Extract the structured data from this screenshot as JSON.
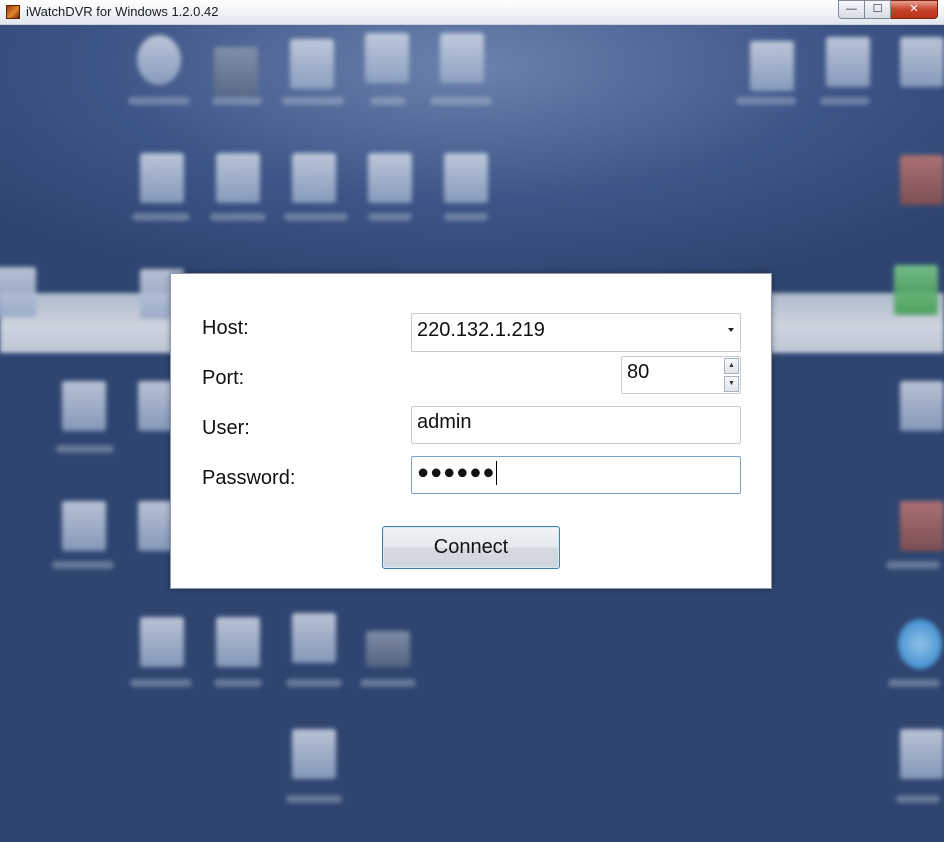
{
  "window": {
    "title": "iWatchDVR for Windows 1.2.0.42",
    "icon": "app-icon",
    "controls": {
      "minimize": "—",
      "maximize": "☐",
      "close": "✕"
    }
  },
  "dialog": {
    "host": {
      "label": "Host:",
      "value": "220.132.1.219"
    },
    "port": {
      "label": "Port:",
      "value": "80"
    },
    "user": {
      "label": "User:",
      "value": "admin"
    },
    "password": {
      "label": "Password:",
      "value": "●●●●●●"
    },
    "connect_label": "Connect"
  },
  "colors": {
    "desktop_background": "#2f4570",
    "button_border": "#3c7fb1",
    "close_button": "#c7432b"
  }
}
